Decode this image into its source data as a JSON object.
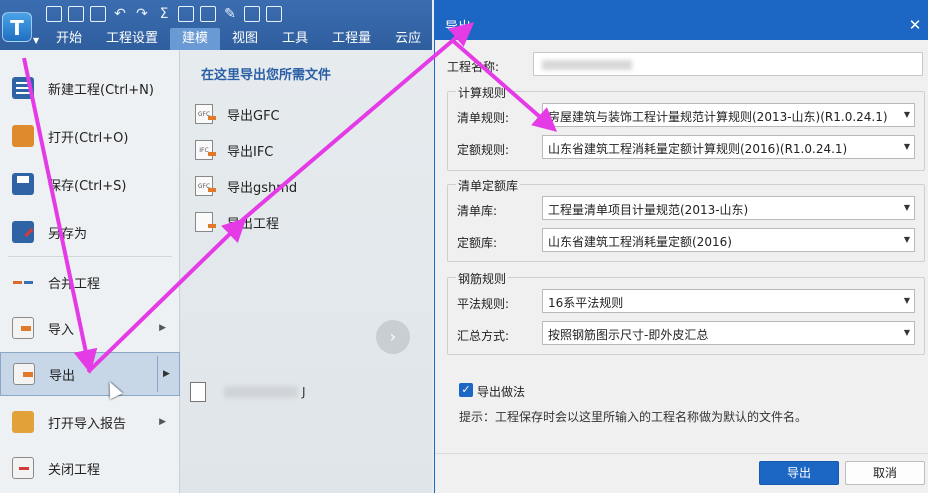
{
  "app": {
    "logo_letter": "T",
    "ribbon_tabs": [
      "开始",
      "工程设置",
      "建模",
      "视图",
      "工具",
      "工程量",
      "云应"
    ],
    "active_tab_index": 2
  },
  "file_menu": {
    "items": [
      {
        "label": "新建工程(Ctrl+N)",
        "icon": "new-project-icon"
      },
      {
        "label": "打开(Ctrl+O)",
        "icon": "open-folder-icon"
      },
      {
        "label": "保存(Ctrl+S)",
        "icon": "save-icon"
      },
      {
        "label": "另存为",
        "icon": "save-as-icon"
      },
      {
        "label": "合并工程",
        "icon": "merge-icon"
      },
      {
        "label": "导入",
        "icon": "import-icon",
        "has_submenu": true
      },
      {
        "label": "导出",
        "icon": "export-icon",
        "has_submenu": true,
        "selected": true
      },
      {
        "label": "打开导入报告",
        "icon": "report-icon",
        "has_submenu": true
      },
      {
        "label": "关闭工程",
        "icon": "close-project-icon"
      }
    ]
  },
  "export_submenu": {
    "header": "在这里导出您所需文件",
    "items": [
      {
        "label": "导出GFC",
        "icon_text": "GFC"
      },
      {
        "label": "导出IFC",
        "icon_text": "IFC"
      },
      {
        "label": "导出gshmd",
        "icon_text": "GFC"
      },
      {
        "label": "导出工程",
        "icon_text": ""
      }
    ],
    "recent_file_suffix": "J"
  },
  "dialog": {
    "title": "导出",
    "project_name_label": "工程名称:",
    "project_name_value": "",
    "groups": {
      "calc_rules": {
        "title": "计算规则",
        "bill_rule_label": "清单规则:",
        "bill_rule_value": "房屋建筑与装饰工程计量规范计算规则(2013-山东)(R1.0.24.1)",
        "quota_rule_label": "定额规则:",
        "quota_rule_value": "山东省建筑工程消耗量定额计算规则(2016)(R1.0.24.1)"
      },
      "bill_quota_lib": {
        "title": "清单定额库",
        "bill_lib_label": "清单库:",
        "bill_lib_value": "工程量清单项目计量规范(2013-山东)",
        "quota_lib_label": "定额库:",
        "quota_lib_value": "山东省建筑工程消耗量定额(2016)"
      },
      "rebar_rules": {
        "title": "钢筋规则",
        "flat_rule_label": "平法规则:",
        "flat_rule_value": "16系平法规则",
        "summary_label": "汇总方式:",
        "summary_value": "按照钢筋图示尺寸-即外皮汇总"
      }
    },
    "export_method_label": "导出做法",
    "export_method_checked": true,
    "hint": "提示：工程保存时会以这里所输入的工程名称做为默认的文件名。",
    "ok_label": "导出",
    "cancel_label": "取消"
  },
  "colors": {
    "accent": "#1c66c4",
    "annotation_arrow": "#e53be6"
  }
}
